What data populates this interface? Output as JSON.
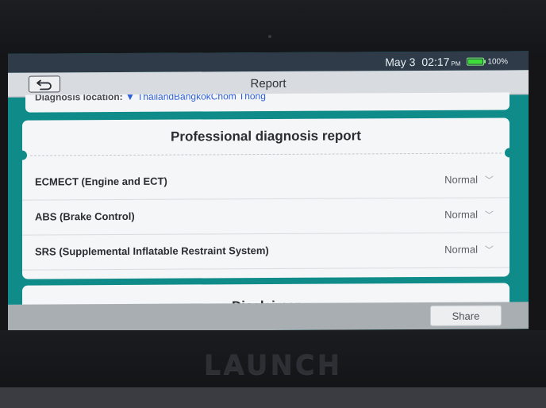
{
  "status_bar": {
    "date": "May 3",
    "time": "02:17",
    "ampm": "PM",
    "battery_text": "100%",
    "battery_level": 1.0
  },
  "titlebar": {
    "title": "Report",
    "back_icon": "back-arrow-icon"
  },
  "location": {
    "label": "Diagnosis location:",
    "value": "▼ ThailandBangkokChom Thong"
  },
  "report": {
    "heading": "Professional diagnosis report",
    "rows": [
      {
        "label": "ECMECT (Engine and ECT)",
        "status": "Normal"
      },
      {
        "label": "ABS (Brake Control)",
        "status": "Normal"
      },
      {
        "label": "SRS (Supplemental Inflatable Restraint System)",
        "status": "Normal"
      }
    ]
  },
  "disclaimer": {
    "title": "Disclaimer"
  },
  "actions": {
    "share_label": "Share"
  },
  "device": {
    "brand": "LAUNCH"
  },
  "colors": {
    "teal_background": "#0f8c8a",
    "statusbar": "#2f3b48",
    "link_blue": "#2f5fd8",
    "battery_green": "#3ddc3a"
  }
}
